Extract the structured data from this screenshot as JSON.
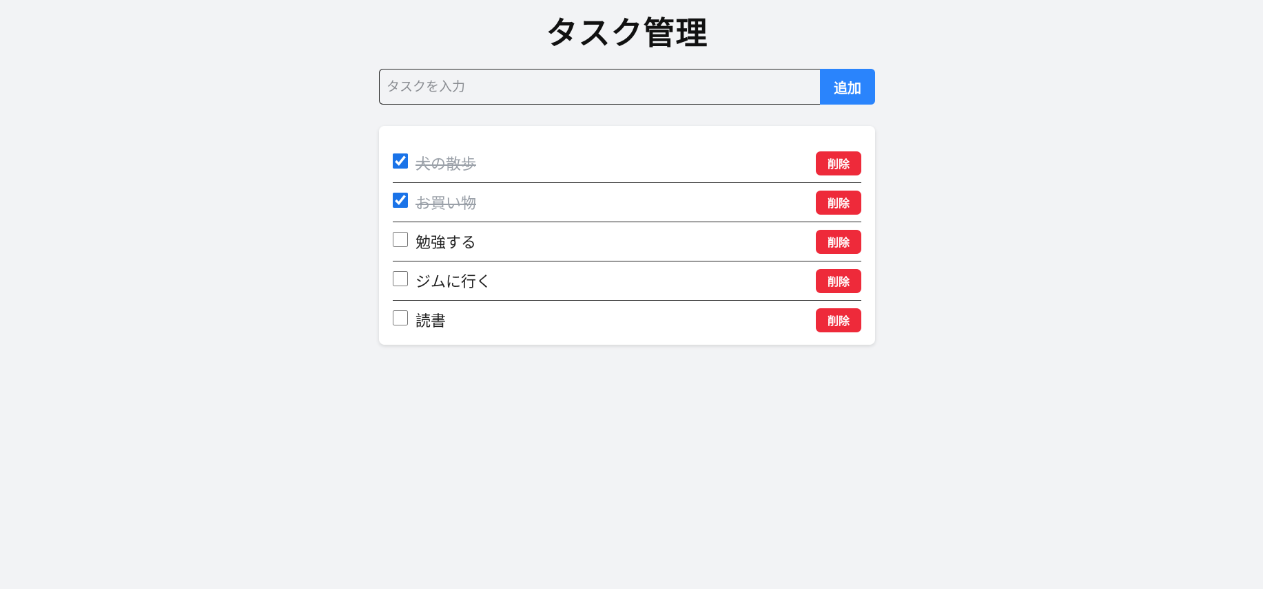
{
  "header": {
    "title": "タスク管理"
  },
  "new_task": {
    "placeholder": "タスクを入力",
    "value": "",
    "add_label": "追加"
  },
  "tasks": [
    {
      "label": "犬の散歩",
      "done": true,
      "delete_label": "削除"
    },
    {
      "label": "お買い物",
      "done": true,
      "delete_label": "削除"
    },
    {
      "label": "勉強する",
      "done": false,
      "delete_label": "削除"
    },
    {
      "label": "ジムに行く",
      "done": false,
      "delete_label": "削除"
    },
    {
      "label": "読書",
      "done": false,
      "delete_label": "削除"
    }
  ],
  "colors": {
    "page_background": "#f2f3f5",
    "accent": "#2a84fc",
    "danger": "#ee2a3a",
    "done_text": "#9aa0a8"
  }
}
